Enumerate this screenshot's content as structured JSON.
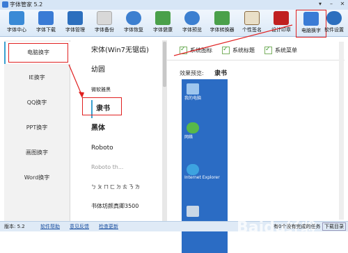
{
  "window": {
    "title": "字体管家 5.2"
  },
  "toolbar": {
    "items": [
      {
        "label": "字体中心",
        "icon": "font-center-icon",
        "color": "#3a8ad6"
      },
      {
        "label": "字体下载",
        "icon": "download-icon",
        "color": "#3a7bd5"
      },
      {
        "label": "字体管理",
        "icon": "font-manage-icon",
        "color": "#2c6fbe"
      },
      {
        "label": "字体备份",
        "icon": "backup-icon",
        "color": "#d8d8d8"
      },
      {
        "label": "字体恢复",
        "icon": "restore-icon",
        "color": "#3c7fd0"
      },
      {
        "label": "字体健康",
        "icon": "health-icon",
        "color": "#4aa04a"
      },
      {
        "label": "字体预览",
        "icon": "magnifier-icon",
        "color": "#3c7fd0"
      },
      {
        "label": "字体转换器",
        "icon": "converter-icon",
        "color": "#4aa04a"
      },
      {
        "label": "个性签名",
        "icon": "signature-icon",
        "color": "#8a6a40"
      },
      {
        "label": "设计印章",
        "icon": "seal-icon",
        "color": "#c02020"
      },
      {
        "label": "电脑换字",
        "icon": "pc-font-icon",
        "color": "#3a7bd5"
      },
      {
        "label": "软件设置",
        "icon": "gear-icon",
        "color": "#2c6fbe"
      }
    ]
  },
  "leftnav": {
    "items": [
      "电脑换字",
      "IE换字",
      "QQ换字",
      "PPT换字",
      "画图换字",
      "Word换字"
    ],
    "selected": 0
  },
  "fonts": {
    "items": [
      "宋体(Win7无锯齿)",
      "幼圆",
      "微软雅黑",
      "隶书",
      "黑体",
      "Roboto",
      "Roboto th...",
      "ㄅㄆㄇㄈㄉㄊㄋㄌ",
      "书体坊颜真卿3500"
    ],
    "selected": 3
  },
  "options": {
    "checks": [
      "系统图标",
      "系统标题",
      "系统菜单"
    ]
  },
  "preview": {
    "label": "效果预览:",
    "font": "隶书",
    "desktop_icons": [
      "我的电脑",
      "网络",
      "Internet Explorer",
      ""
    ]
  },
  "status": {
    "version": "版本: 5.2",
    "links": [
      "软件帮助",
      "意见反馈",
      "检查更新"
    ],
    "tasks": "有0个没有完成的任务",
    "download": "下载目录"
  },
  "watermark": "Baidu经验"
}
